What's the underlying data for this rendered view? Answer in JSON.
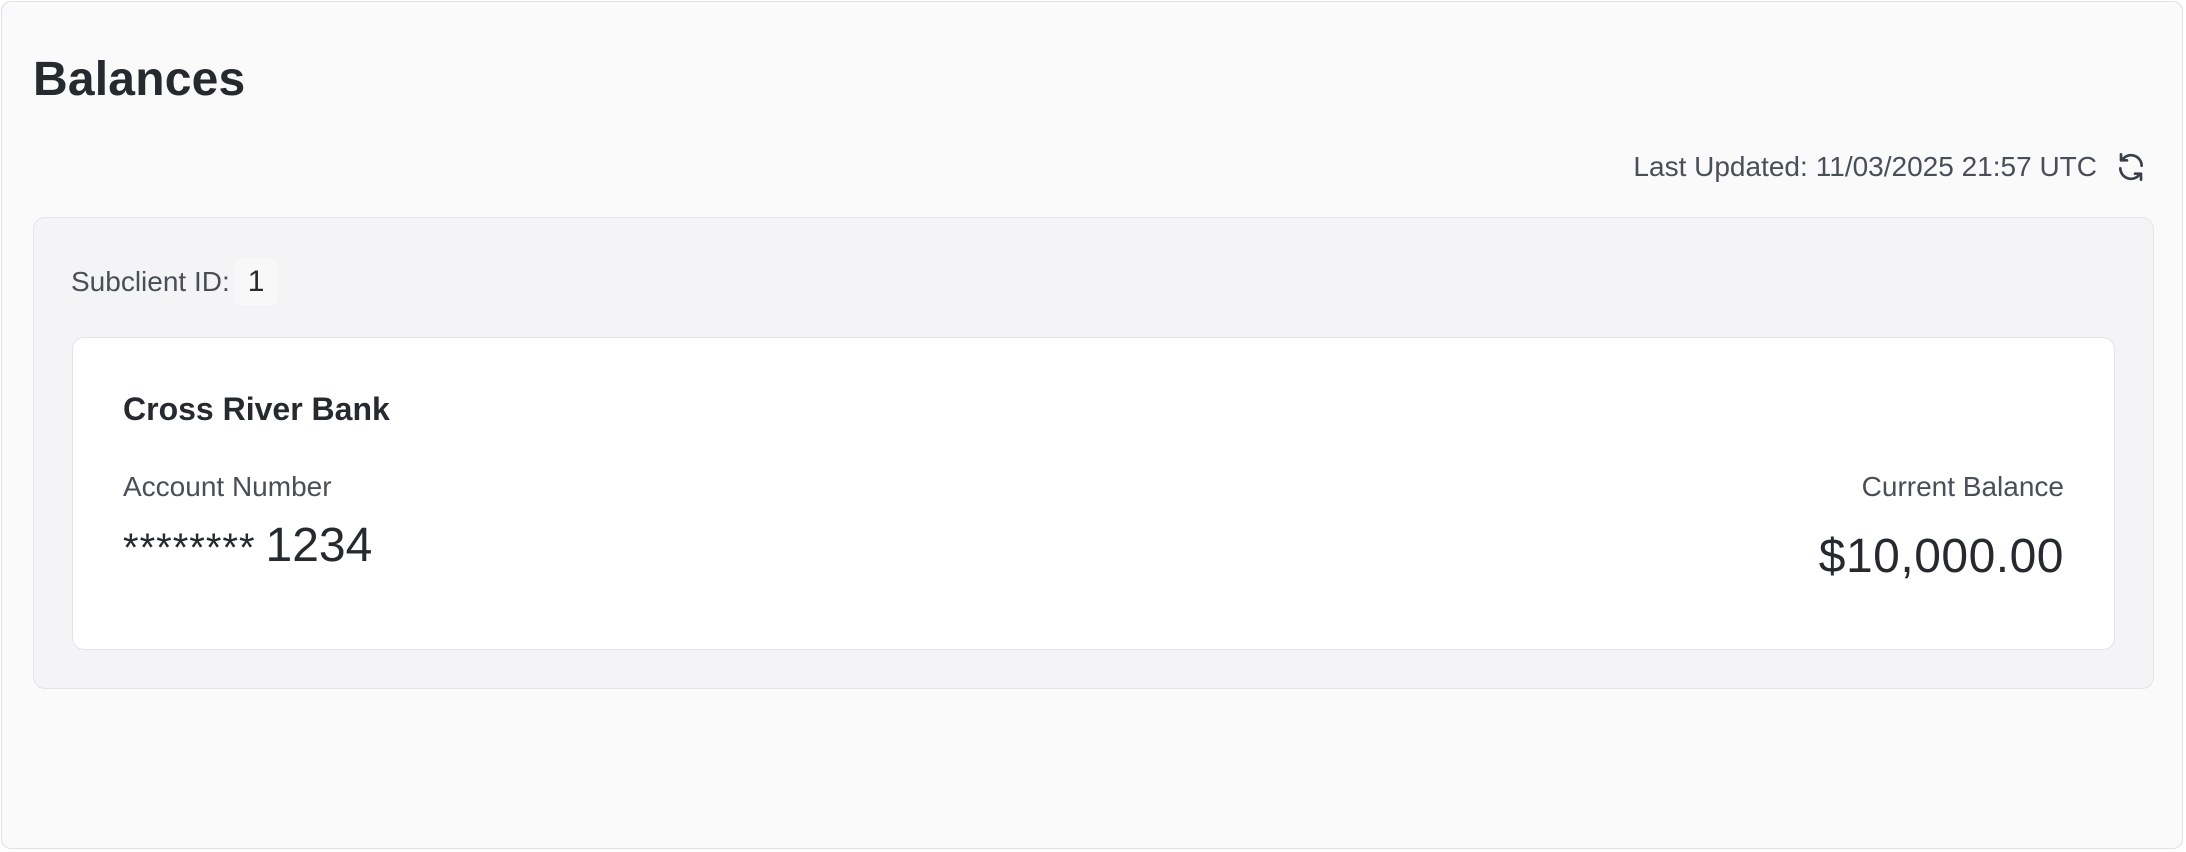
{
  "header": {
    "title": "Balances"
  },
  "status": {
    "last_updated_label": "Last Updated:",
    "last_updated_value": "11/03/2025 21:57 UTC",
    "refresh_icon": "refresh-icon"
  },
  "subclient": {
    "label": "Subclient ID:",
    "id": "1"
  },
  "accounts": [
    {
      "bank_name": "Cross River Bank",
      "account_number_label": "Account Number",
      "account_number_mask": "********",
      "account_number_last4": "1234",
      "current_balance_label": "Current Balance",
      "current_balance": "$10,000.00"
    }
  ]
}
